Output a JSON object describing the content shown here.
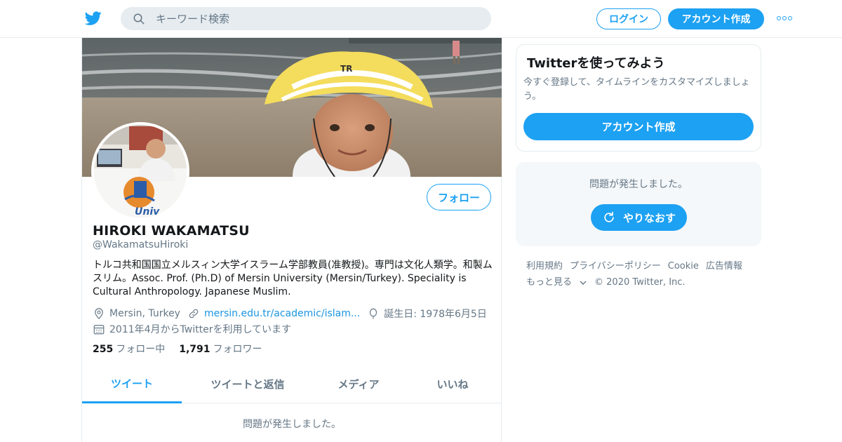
{
  "header": {
    "search_placeholder": "キーワード検索",
    "login_label": "ログイン",
    "signup_label": "アカウント作成"
  },
  "profile": {
    "follow_label": "フォロー",
    "name": "HIROKI WAKAMATSU",
    "handle": "@WakamatsuHiroki",
    "bio": "トルコ共和国国立メルスィン大学イスラーム学部教員(准教授)。専門は文化人類学。和製ムスリム。Assoc. Prof. (Ph.D) of Mersin University (Mersin/Turkey). Speciality is Cultural Anthropology. Japanese Muslim.",
    "location": "Mersin, Turkey",
    "website": "mersin.edu.tr/academic/islam...",
    "birthday": "誕生日: 1978年6月5日",
    "joined": "2011年4月からTwitterを利用しています",
    "following_count": "255",
    "following_label": "フォロー中",
    "followers_count": "1,791",
    "followers_label": "フォロワー"
  },
  "tabs": [
    {
      "label": "ツイート",
      "active": true
    },
    {
      "label": "ツイートと返信",
      "active": false
    },
    {
      "label": "メディア",
      "active": false
    },
    {
      "label": "いいね",
      "active": false
    }
  ],
  "timeline": {
    "error_text": "問題が発生しました。"
  },
  "sidebar": {
    "card_title": "Twitterを使ってみよう",
    "card_text": "今すぐ登録して、タイムラインをカスタマイズしましょう。",
    "card_button": "アカウント作成",
    "error_text": "問題が発生しました。",
    "retry_label": "やりなおす"
  },
  "footer": {
    "links": [
      "利用規約",
      "プライバシーポリシー",
      "Cookie",
      "広告情報"
    ],
    "more_label": "もっと見る",
    "copyright": "© 2020 Twitter, Inc."
  },
  "colors": {
    "accent": "#1da1f2",
    "text": "#14171a",
    "secondary": "#657786",
    "border": "#e6ecf0"
  },
  "icons": [
    "twitter-bird-icon",
    "search-icon",
    "more-icon",
    "location-icon",
    "link-icon",
    "balloon-icon",
    "calendar-icon",
    "refresh-icon",
    "chevron-down-icon"
  ]
}
